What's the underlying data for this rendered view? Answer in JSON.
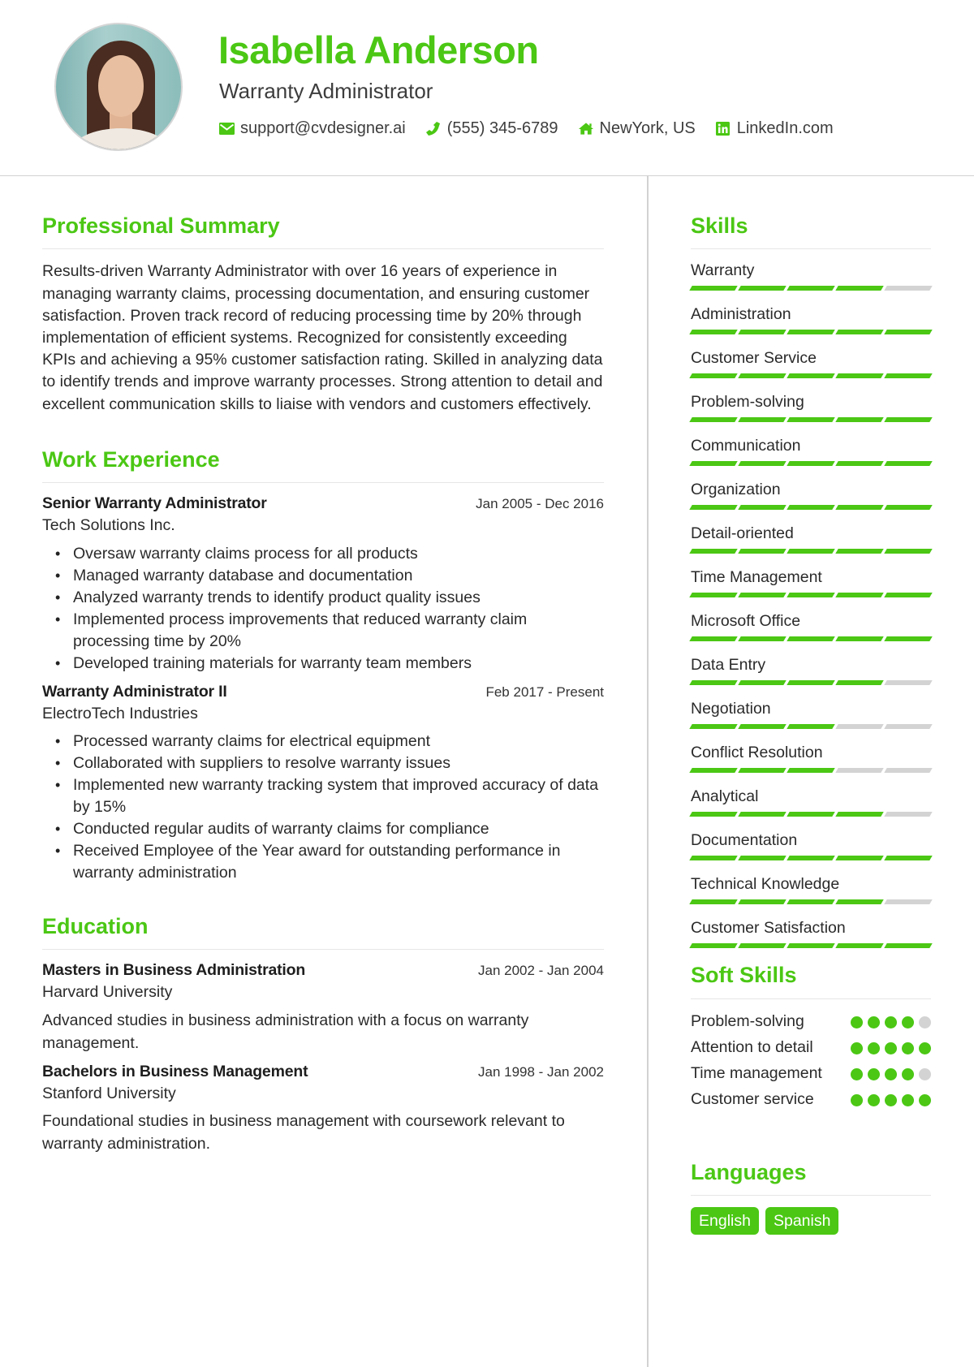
{
  "header": {
    "name": "Isabella Anderson",
    "title": "Warranty Administrator",
    "contacts": [
      {
        "icon": "envelope-icon",
        "text": "support@cvdesigner.ai"
      },
      {
        "icon": "phone-icon",
        "text": "(555) 345-6789"
      },
      {
        "icon": "home-icon",
        "text": "NewYork, US"
      },
      {
        "icon": "linkedin-icon",
        "text": "LinkedIn.com"
      }
    ]
  },
  "colors": {
    "accent": "#4bc714",
    "inactive": "#d3d3d3"
  },
  "summary": {
    "heading": "Professional Summary",
    "text": "Results-driven Warranty Administrator with over 16 years of experience in managing warranty claims, processing documentation, and ensuring customer satisfaction. Proven track record of reducing processing time by 20% through implementation of efficient systems. Recognized for consistently exceeding KPIs and achieving a 95% customer satisfaction rating. Skilled in analyzing data to identify trends and improve warranty processes. Strong attention to detail and excellent communication skills to liaise with vendors and customers effectively."
  },
  "experience": {
    "heading": "Work Experience",
    "jobs": [
      {
        "title": "Senior Warranty Administrator",
        "dates": "Jan 2005 - Dec 2016",
        "company": "Tech Solutions Inc.",
        "bullets": [
          "Oversaw warranty claims process for all products",
          "Managed warranty database and documentation",
          "Analyzed warranty trends to identify product quality issues",
          "Implemented process improvements that reduced warranty claim processing time by 20%",
          "Developed training materials for warranty team members"
        ]
      },
      {
        "title": "Warranty Administrator II",
        "dates": "Feb 2017 - Present",
        "company": "ElectroTech Industries",
        "bullets": [
          "Processed warranty claims for electrical equipment",
          "Collaborated with suppliers to resolve warranty issues",
          "Implemented new warranty tracking system that improved accuracy of data by 15%",
          "Conducted regular audits of warranty claims for compliance",
          "Received Employee of the Year award for outstanding performance in warranty administration"
        ]
      }
    ]
  },
  "education": {
    "heading": "Education",
    "items": [
      {
        "degree": "Masters in Business Administration",
        "dates": "Jan 2002 - Jan 2004",
        "school": "Harvard University",
        "description": "Advanced studies in business administration with a focus on warranty management."
      },
      {
        "degree": "Bachelors in Business Management",
        "dates": "Jan 1998 - Jan 2002",
        "school": "Stanford University",
        "description": "Foundational studies in business management with coursework relevant to warranty administration."
      }
    ]
  },
  "skills": {
    "heading": "Skills",
    "max": 5,
    "items": [
      {
        "name": "Warranty",
        "level": 4
      },
      {
        "name": "Administration",
        "level": 5
      },
      {
        "name": "Customer Service",
        "level": 5
      },
      {
        "name": "Problem-solving",
        "level": 5
      },
      {
        "name": "Communication",
        "level": 5
      },
      {
        "name": "Organization",
        "level": 5
      },
      {
        "name": "Detail-oriented",
        "level": 5
      },
      {
        "name": "Time Management",
        "level": 5
      },
      {
        "name": "Microsoft Office",
        "level": 5
      },
      {
        "name": "Data Entry",
        "level": 4
      },
      {
        "name": "Negotiation",
        "level": 3
      },
      {
        "name": "Conflict Resolution",
        "level": 3
      },
      {
        "name": "Analytical",
        "level": 4
      },
      {
        "name": "Documentation",
        "level": 5
      },
      {
        "name": "Technical Knowledge",
        "level": 4
      },
      {
        "name": "Customer Satisfaction",
        "level": 5
      }
    ]
  },
  "soft_skills": {
    "heading": "Soft Skills",
    "max": 5,
    "items": [
      {
        "name": "Problem-solving",
        "level": 4
      },
      {
        "name": "Attention to detail",
        "level": 5
      },
      {
        "name": "Time management",
        "level": 4
      },
      {
        "name": "Customer service",
        "level": 5
      }
    ]
  },
  "languages": {
    "heading": "Languages",
    "items": [
      "English",
      "Spanish"
    ]
  }
}
